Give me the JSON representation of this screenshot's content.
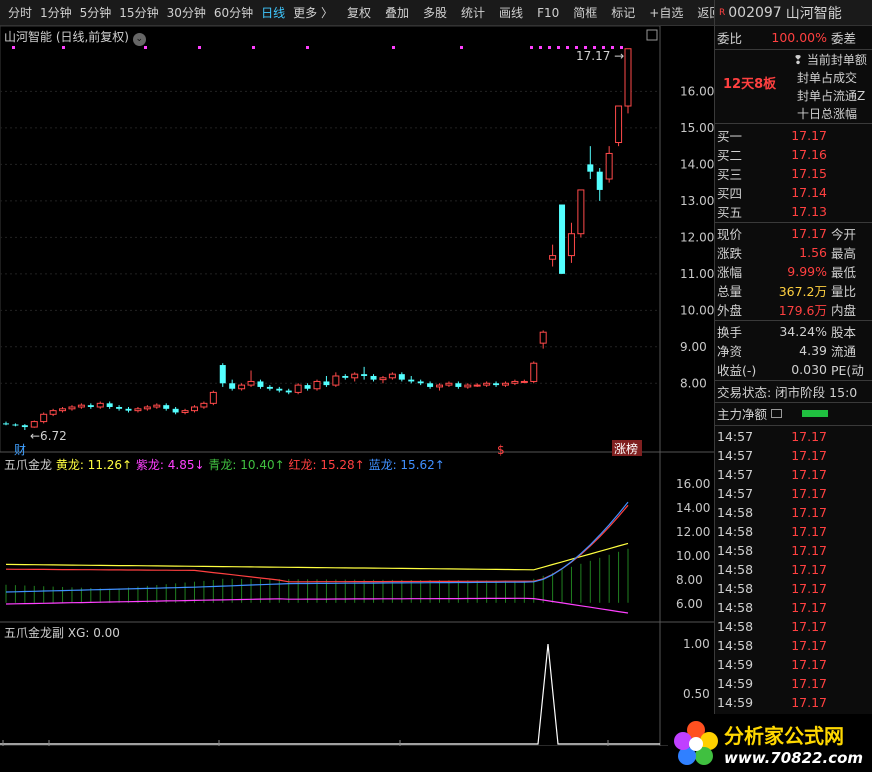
{
  "toolbar": {
    "items": [
      "分时",
      "1分钟",
      "5分钟",
      "15分钟",
      "30分钟",
      "60分钟",
      "日线",
      "更多 〉"
    ],
    "actions": [
      "复权",
      "叠加",
      "多股",
      "统计",
      "画线",
      "F10",
      "简框",
      "标记",
      "+自选",
      "返回"
    ]
  },
  "stock": {
    "code": "002097",
    "name": "山河智能",
    "badge": "R"
  },
  "main_panel": {
    "title": "山河智能 (日线,前复权)",
    "high_label": "17.17",
    "low_label": "←6.72",
    "markers": [
      "财",
      "$",
      "涨榜"
    ],
    "y_ticks": [
      "16.00",
      "15.00",
      "14.00",
      "13.00",
      "12.00",
      "11.00",
      "10.00",
      "9.00",
      "8.00"
    ]
  },
  "chart_data": [
    {
      "type": "candlestick",
      "title": "山河智能 (日线,前复权)",
      "ylim": [
        6.5,
        17.3
      ],
      "y_ticks": [
        8,
        9,
        10,
        11,
        12,
        13,
        14,
        15,
        16
      ],
      "x_labels": [
        "2025年",
        "5",
        "6",
        "7",
        "8"
      ],
      "ohlc": [
        [
          6.9,
          6.95,
          6.85,
          6.88
        ],
        [
          6.87,
          6.9,
          6.82,
          6.85
        ],
        [
          6.85,
          6.88,
          6.72,
          6.8
        ],
        [
          6.8,
          6.98,
          6.78,
          6.95
        ],
        [
          6.95,
          7.2,
          6.9,
          7.15
        ],
        [
          7.15,
          7.3,
          7.1,
          7.25
        ],
        [
          7.25,
          7.35,
          7.2,
          7.3
        ],
        [
          7.3,
          7.4,
          7.25,
          7.35
        ],
        [
          7.35,
          7.45,
          7.3,
          7.4
        ],
        [
          7.4,
          7.45,
          7.3,
          7.35
        ],
        [
          7.35,
          7.5,
          7.3,
          7.45
        ],
        [
          7.45,
          7.5,
          7.3,
          7.35
        ],
        [
          7.35,
          7.4,
          7.25,
          7.3
        ],
        [
          7.3,
          7.35,
          7.2,
          7.25
        ],
        [
          7.25,
          7.35,
          7.2,
          7.3
        ],
        [
          7.3,
          7.4,
          7.25,
          7.35
        ],
        [
          7.35,
          7.45,
          7.3,
          7.4
        ],
        [
          7.4,
          7.45,
          7.25,
          7.3
        ],
        [
          7.3,
          7.35,
          7.15,
          7.2
        ],
        [
          7.2,
          7.3,
          7.15,
          7.25
        ],
        [
          7.25,
          7.4,
          7.2,
          7.35
        ],
        [
          7.35,
          7.5,
          7.3,
          7.45
        ],
        [
          7.45,
          7.8,
          7.4,
          7.75
        ],
        [
          8.5,
          8.55,
          7.9,
          8.0
        ],
        [
          8.0,
          8.1,
          7.8,
          7.85
        ],
        [
          7.85,
          8.0,
          7.8,
          7.95
        ],
        [
          7.95,
          8.35,
          7.9,
          8.05
        ],
        [
          8.05,
          8.1,
          7.85,
          7.9
        ],
        [
          7.9,
          7.95,
          7.8,
          7.85
        ],
        [
          7.85,
          7.9,
          7.75,
          7.8
        ],
        [
          7.8,
          7.85,
          7.7,
          7.75
        ],
        [
          7.75,
          8.0,
          7.7,
          7.95
        ],
        [
          7.95,
          8.0,
          7.8,
          7.85
        ],
        [
          7.85,
          8.1,
          7.8,
          8.05
        ],
        [
          8.05,
          8.2,
          7.9,
          7.95
        ],
        [
          7.95,
          8.3,
          7.9,
          8.2
        ],
        [
          8.2,
          8.25,
          8.1,
          8.15
        ],
        [
          8.15,
          8.3,
          8.05,
          8.25
        ],
        [
          8.25,
          8.45,
          8.1,
          8.2
        ],
        [
          8.2,
          8.25,
          8.05,
          8.1
        ],
        [
          8.1,
          8.2,
          8.0,
          8.15
        ],
        [
          8.15,
          8.3,
          8.1,
          8.25
        ],
        [
          8.25,
          8.3,
          8.05,
          8.1
        ],
        [
          8.1,
          8.2,
          8.0,
          8.05
        ],
        [
          8.05,
          8.1,
          7.95,
          8.0
        ],
        [
          8.0,
          8.05,
          7.85,
          7.9
        ],
        [
          7.9,
          8.0,
          7.8,
          7.95
        ],
        [
          7.95,
          8.05,
          7.9,
          8.0
        ],
        [
          8.0,
          8.05,
          7.85,
          7.9
        ],
        [
          7.9,
          8.0,
          7.85,
          7.95
        ],
        [
          7.95,
          8.0,
          7.9,
          7.95
        ],
        [
          7.95,
          8.05,
          7.9,
          8.0
        ],
        [
          8.0,
          8.05,
          7.9,
          7.95
        ],
        [
          7.95,
          8.05,
          7.9,
          8.0
        ],
        [
          8.0,
          8.1,
          7.95,
          8.05
        ],
        [
          8.05,
          8.1,
          8.0,
          8.05
        ],
        [
          8.05,
          8.6,
          8.0,
          8.55
        ],
        [
          9.1,
          9.45,
          8.95,
          9.4
        ],
        [
          11.4,
          11.8,
          11.2,
          11.5
        ],
        [
          12.9,
          12.9,
          11.0,
          11.0
        ],
        [
          11.5,
          12.4,
          11.3,
          12.1
        ],
        [
          12.1,
          13.3,
          12.0,
          13.3
        ],
        [
          14.0,
          14.5,
          13.6,
          13.8
        ],
        [
          13.8,
          13.9,
          13.0,
          13.3
        ],
        [
          13.6,
          14.5,
          13.5,
          14.3
        ],
        [
          14.6,
          15.6,
          14.5,
          15.6
        ],
        [
          15.6,
          17.17,
          15.4,
          17.17
        ]
      ]
    },
    {
      "type": "line",
      "title": "五爪金龙",
      "ylim": [
        5.0,
        17.0
      ],
      "y_ticks": [
        6,
        8,
        10,
        12,
        14,
        16
      ],
      "series": [
        {
          "name": "黄龙",
          "value": "11.26",
          "color": "#ffff40"
        },
        {
          "name": "紫龙",
          "value": "4.85",
          "color": "#ff40ff"
        },
        {
          "name": "青龙",
          "value": "10.40",
          "color": "#40c040"
        },
        {
          "name": "红龙",
          "value": "15.28",
          "color": "#ff4040"
        },
        {
          "name": "蓝龙",
          "value": "15.62",
          "color": "#4090ff"
        }
      ]
    },
    {
      "type": "line",
      "title": "五爪金龙副",
      "ylim": [
        0,
        1.1
      ],
      "y_ticks": [
        0.5,
        1.0
      ],
      "series": [
        {
          "name": "XG",
          "value": "0.00",
          "color": "#ffffff"
        }
      ]
    }
  ],
  "sub1": {
    "title": "五爪金龙",
    "labels": [
      {
        "k": "黄龙:",
        "v": "11.26",
        "arrow": "↑"
      },
      {
        "k": "紫龙:",
        "v": "4.85",
        "arrow": "↓"
      },
      {
        "k": "青龙:",
        "v": "10.40",
        "arrow": "↑"
      },
      {
        "k": "红龙:",
        "v": "15.28",
        "arrow": "↑"
      },
      {
        "k": "蓝龙:",
        "v": "15.62",
        "arrow": "↑"
      }
    ],
    "y_ticks": [
      "16.00",
      "14.00",
      "12.00",
      "10.00",
      "8.00",
      "6.00"
    ]
  },
  "sub2": {
    "title": "五爪金龙副",
    "xg": "XG: 0.00",
    "y_ticks": [
      "1.00",
      "0.50"
    ]
  },
  "xaxis": {
    "labels": [
      "2025年",
      "5",
      "6",
      "7",
      "8"
    ]
  },
  "right": {
    "weibi": {
      "k": "委比",
      "v": "100.00%",
      "k2": "委差"
    },
    "limit": {
      "days": "12天8板",
      "items": [
        "当前封单额",
        "封单占成交",
        "封单占流通Z",
        "十日总涨幅"
      ]
    },
    "bids": [
      {
        "k": "买一",
        "v": "17.17"
      },
      {
        "k": "买二",
        "v": "17.16"
      },
      {
        "k": "买三",
        "v": "17.15"
      },
      {
        "k": "买四",
        "v": "17.14"
      },
      {
        "k": "买五",
        "v": "17.13"
      }
    ],
    "quote": [
      {
        "k": "现价",
        "v": "17.17",
        "k2": "今开",
        "c": "#ff4040"
      },
      {
        "k": "涨跌",
        "v": "1.56",
        "k2": "最高",
        "c": "#ff4040"
      },
      {
        "k": "涨幅",
        "v": "9.99%",
        "k2": "最低",
        "c": "#ff4040"
      },
      {
        "k": "总量",
        "v": "367.2万",
        "k2": "量比",
        "c": "#ffd040"
      },
      {
        "k": "外盘",
        "v": "179.6万",
        "k2": "内盘",
        "c": "#ff4040"
      }
    ],
    "fund": [
      {
        "k": "换手",
        "v": "34.24%",
        "k2": "股本"
      },
      {
        "k": "净资",
        "v": "4.39",
        "k2": "流通"
      },
      {
        "k": "收益(-)",
        "v": "0.030",
        "k2": "PE(动"
      }
    ],
    "status": "交易状态: 闭市阶段 15:0",
    "flow_title": "主力净额",
    "ticks": [
      {
        "t": "14:57",
        "p": "17.17"
      },
      {
        "t": "14:57",
        "p": "17.17"
      },
      {
        "t": "14:57",
        "p": "17.17"
      },
      {
        "t": "14:57",
        "p": "17.17"
      },
      {
        "t": "14:58",
        "p": "17.17"
      },
      {
        "t": "14:58",
        "p": "17.17"
      },
      {
        "t": "14:58",
        "p": "17.17"
      },
      {
        "t": "14:58",
        "p": "17.17"
      },
      {
        "t": "14:58",
        "p": "17.17"
      },
      {
        "t": "14:58",
        "p": "17.17"
      },
      {
        "t": "14:58",
        "p": "17.17"
      },
      {
        "t": "14:58",
        "p": "17.17"
      },
      {
        "t": "14:59",
        "p": "17.17"
      },
      {
        "t": "14:59",
        "p": "17.17"
      },
      {
        "t": "14:59",
        "p": "17.17"
      },
      {
        "t": "14:59",
        "p": "17.17"
      }
    ]
  },
  "watermark": {
    "title": "分析家公式网",
    "url": "www.70822.com"
  }
}
